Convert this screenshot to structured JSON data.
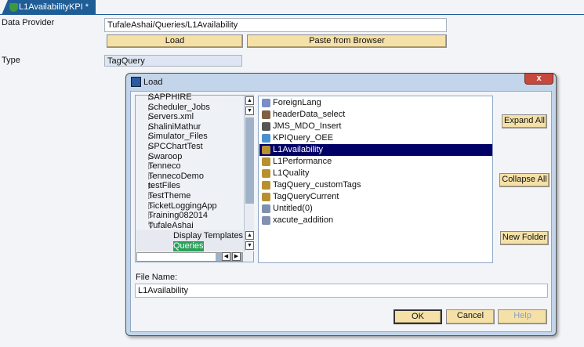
{
  "tab": {
    "title": "L1AvailabilityKPI *"
  },
  "form": {
    "data_provider_label": "Data Provider",
    "data_provider_value": "TufaleAshai/Queries/L1Availability",
    "load_label": "Load",
    "paste_label": "Paste from Browser",
    "type_label": "Type",
    "type_value": "TagQuery"
  },
  "dialog": {
    "title": "Load",
    "close": "x",
    "tree": [
      "SAPPHIRE",
      "Scheduler_Jobs",
      "Servers.xml",
      "ShaliniMathur",
      "Simulator_Files",
      "SPCChartTest",
      "Swaroop",
      "Tenneco",
      "TennecoDemo",
      "testFiles",
      "TestTheme",
      "TicketLoggingApp",
      "Training082014",
      "TufaleAshai"
    ],
    "subtree": [
      "Display Templates",
      "Queries"
    ],
    "files": [
      "ForeignLang",
      "headerData_select",
      "JMS_MDO_Insert",
      "KPIQuery_OEE",
      "L1Availability",
      "L1Performance",
      "L1Quality",
      "TagQuery_customTags",
      "TagQueryCurrent",
      "Untitled(0)",
      "xacute_addition"
    ],
    "selected_file": "L1Availability",
    "expand_all": "Expand All",
    "collapse_all": "Collapse All",
    "new_folder": "New Folder",
    "file_name_label": "File Name:",
    "file_name_value": "L1Availability",
    "ok": "OK",
    "cancel": "Cancel",
    "help": "Help"
  }
}
